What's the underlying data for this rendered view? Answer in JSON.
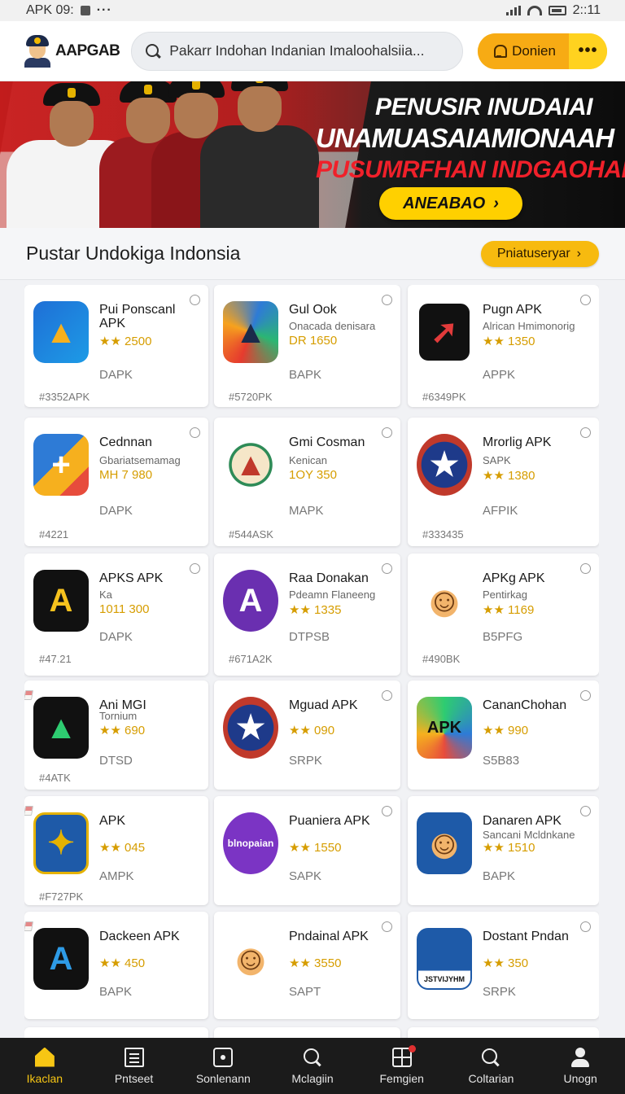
{
  "status_bar": {
    "left_text": "APK 09:",
    "time": "2::11"
  },
  "header": {
    "logo_text": "AAPGAB",
    "search_text": "Pakarr Indohan   Indanian  Imaloohalsiia...",
    "notify_label": "Donien",
    "more_label": "•••"
  },
  "banner": {
    "line1": "PENUSIR INUDAIAI",
    "line2": "UNAMUASAIAMIONAAH",
    "line3": "PUSUMRFHAN INDGAOHAN",
    "button_label": "ANEABAO",
    "colors": {
      "accent": "#ffd000",
      "red": "#f0202a"
    }
  },
  "section": {
    "title": "Pustar Undokiga Indonsia",
    "button_label": "Pniatuseryar"
  },
  "apps": [
    {
      "name": "Pui Ponscanl APK",
      "sub": "",
      "rating": "★★ 2500",
      "category": "DAPK",
      "code": "#3352APK",
      "icon": "triangle-blue-icon"
    },
    {
      "name": "Gul Ook",
      "sub": "Onacada denisara",
      "rating": "DR 1650",
      "category": "BAPK",
      "code": "#5720PK",
      "icon": "ark-logo-icon"
    },
    {
      "name": "Pugn APK",
      "sub": "Alrican  Hmimonorig",
      "rating": "★★ 1350",
      "category": "APPK",
      "code": "#6349PK",
      "icon": "red-arrow-icon"
    },
    {
      "name": "Cednnan",
      "sub": "Gbariatsemamag",
      "rating": "MH 7 980",
      "category": "DAPK",
      "code": "#4221",
      "icon": "folded-colors-icon"
    },
    {
      "name": "Gmi Cosman",
      "sub": "Kenican",
      "rating": "1OY 350",
      "category": "MAPK",
      "code": "#544ASK",
      "icon": "emblem-icon"
    },
    {
      "name": "Mrorlig APK",
      "sub": "SAPK",
      "rating": "★★ 1380",
      "category": "AFPIK",
      "code": "#333435",
      "icon": "seal-icon"
    },
    {
      "name": "APKS APK",
      "sub": "Ka",
      "rating": "1011 300",
      "category": "DAPK",
      "code": "#47.21",
      "icon": "a-dark-icon"
    },
    {
      "name": "Raa Donakan",
      "sub": "Pdeamn Flaneeng",
      "rating": "★★ 1335",
      "category": "DTPSB",
      "code": "#671A2K",
      "icon": "purple-a-icon"
    },
    {
      "name": "APKg APK",
      "sub": "Pentirkag",
      "rating": "★★ 1169",
      "category": "B5PFG",
      "code": "#490BK",
      "icon": "mascot-icon"
    },
    {
      "name": "Ani MGI",
      "sub": "Tornium",
      "rating": "★★ 690",
      "category": "DTSD",
      "code": "#4ATK",
      "icon": "triangle-dark-icon"
    },
    {
      "name": "Mguad APK",
      "sub": "",
      "rating": "★★ 090",
      "category": "SRPK",
      "code": "",
      "icon": "seal-icon"
    },
    {
      "name": "CananChohan",
      "sub": "",
      "rating": "★★ 990",
      "category": "S5B83",
      "code": "",
      "icon": "apk-prism-icon"
    },
    {
      "name": "APK",
      "sub": "",
      "rating": "★★ 045",
      "category": "AMPK",
      "code": "#F727PK",
      "icon": "badge-blue-icon"
    },
    {
      "name": "Puaniera APK",
      "sub": "",
      "rating": "★★ 1550",
      "category": "SAPK",
      "code": "",
      "icon": "purple-text-icon",
      "icon_text": "blnopaian"
    },
    {
      "name": "Danaren APK",
      "sub": "Sancani Mcldnkane",
      "rating": "★★ 1510",
      "category": "BAPK",
      "code": "",
      "icon": "mascot-blue-icon"
    },
    {
      "name": "Dackeen APK",
      "sub": "",
      "rating": "★★ 450",
      "category": "BAPK",
      "code": "",
      "icon": "a-blue-icon"
    },
    {
      "name": "Pndainal APK",
      "sub": "",
      "rating": "★★ 3550",
      "category": "SAPT",
      "code": "",
      "icon": "mascot-icon"
    },
    {
      "name": "Dostant Pndan",
      "sub": "",
      "rating": "★★ 350",
      "category": "SRPK",
      "code": "",
      "icon": "jst-icon",
      "icon_text": "JSTVIJYHM"
    }
  ],
  "nav": [
    {
      "label": "Ikaclan",
      "icon": "home-icon",
      "active": true
    },
    {
      "label": "Pntseet",
      "icon": "list-icon"
    },
    {
      "label": "Sonlenann",
      "icon": "dice-icon"
    },
    {
      "label": "Mclagiin",
      "icon": "search-icon"
    },
    {
      "label": "Femgien",
      "icon": "grid-icon"
    },
    {
      "label": "Coltarian",
      "icon": "search-icon"
    },
    {
      "label": "Unogn",
      "icon": "user-icon"
    }
  ]
}
